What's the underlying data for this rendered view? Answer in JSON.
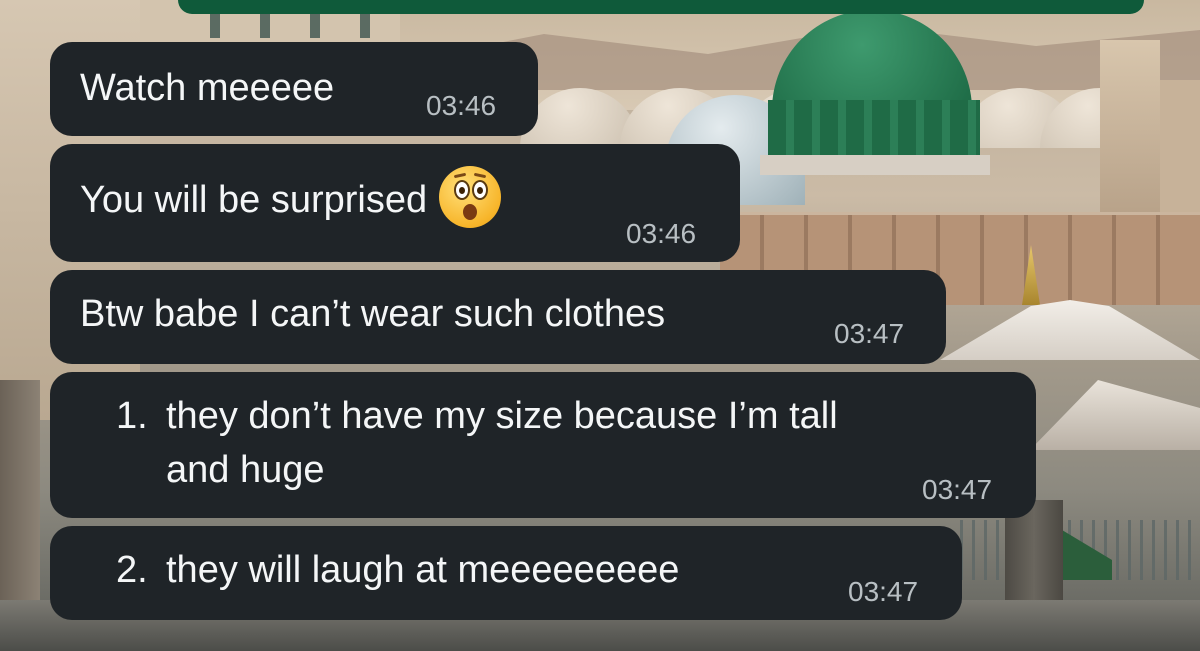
{
  "chat": {
    "messages": [
      {
        "text": "Watch meeeee",
        "time": "03:46"
      },
      {
        "text": "You will be surprised",
        "emoji": "astonished-face-emoji",
        "time": "03:46"
      },
      {
        "text": "Btw babe I can’t wear such clothes",
        "time": "03:47"
      },
      {
        "num": "1.",
        "line1": "they don’t have my size because I’m tall",
        "line2": "and huge",
        "time": "03:47"
      },
      {
        "num": "2.",
        "text": "they will laugh at meeeeeeeee",
        "time": "03:47"
      }
    ]
  },
  "colors": {
    "bubble_bg": "#1f2428",
    "text": "#f4f6f7",
    "timestamp": "#b8bfc3",
    "top_strip": "#0f5a3a"
  },
  "wallpaper": {
    "icon": "mosque-wallpaper-image"
  }
}
